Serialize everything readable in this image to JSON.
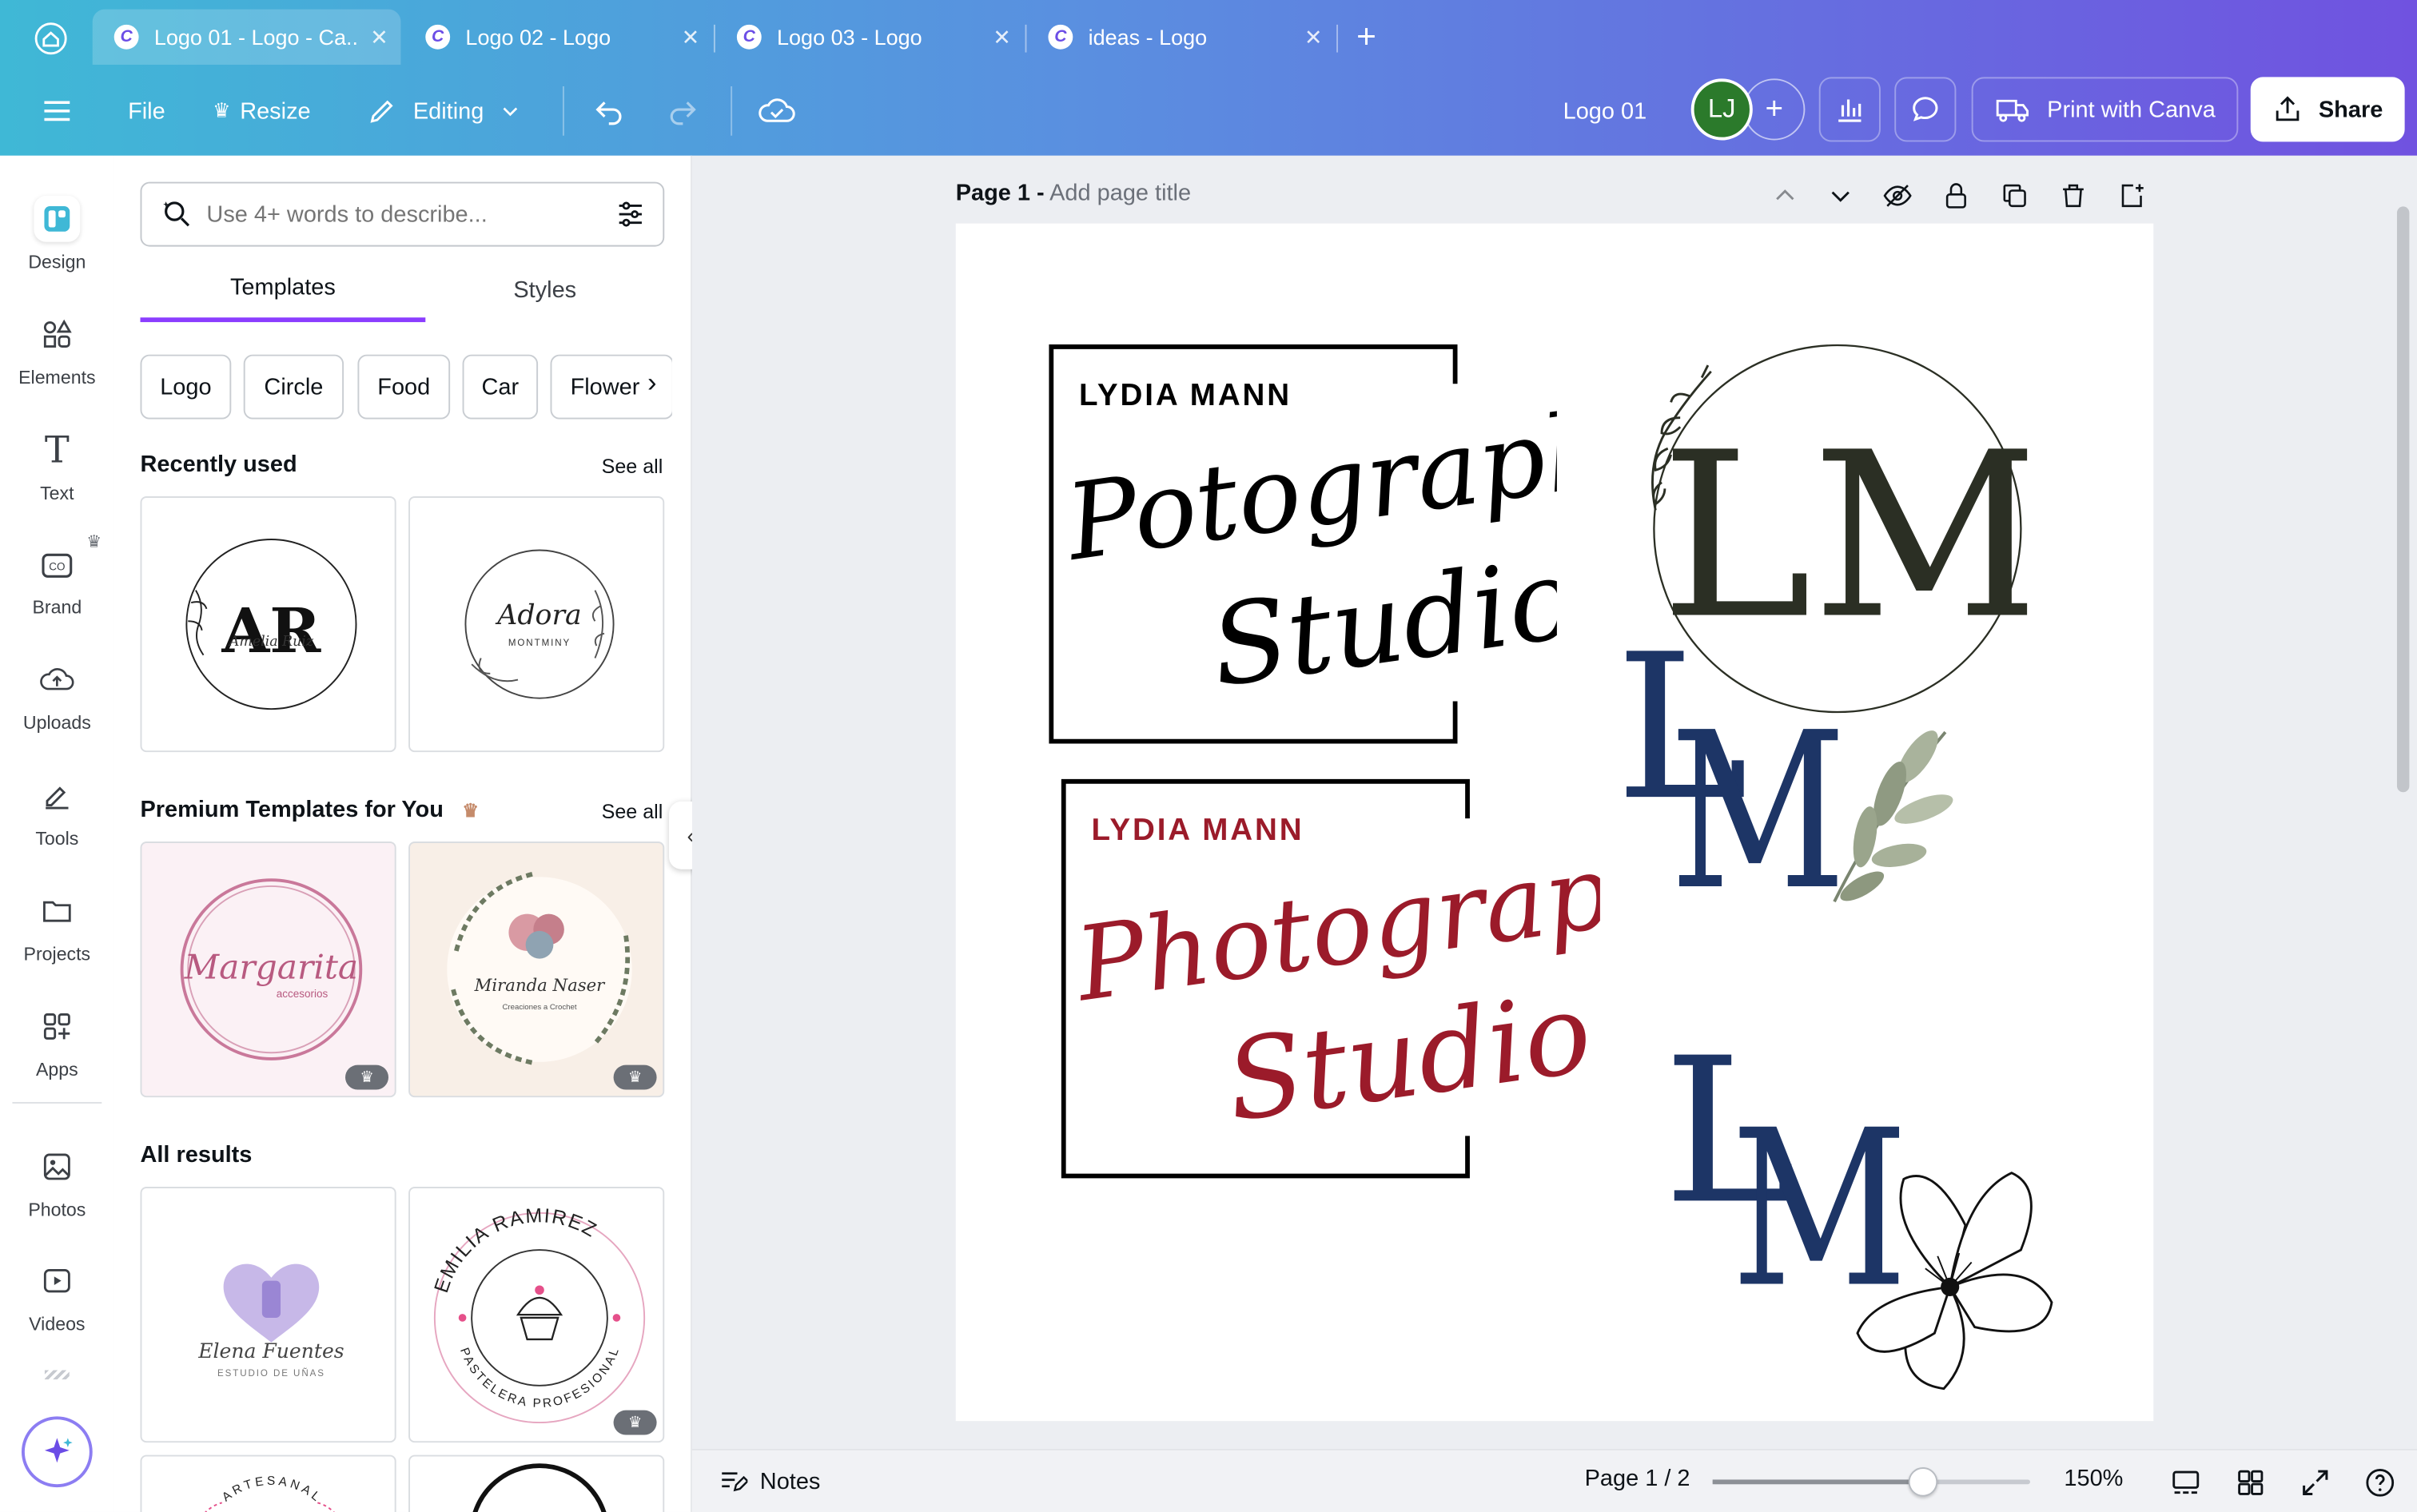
{
  "tabs": [
    {
      "title": "Logo 01 - Logo - Ca...",
      "active": true
    },
    {
      "title": "Logo 02 - Logo",
      "active": false
    },
    {
      "title": "Logo 03 - Logo",
      "active": false
    },
    {
      "title": "ideas - Logo",
      "active": false
    }
  ],
  "toolbar": {
    "file": "File",
    "resize": "Resize",
    "editing": "Editing",
    "doc_title": "Logo 01",
    "avatar_initials": "LJ",
    "print": "Print with Canva",
    "share": "Share"
  },
  "rail": [
    {
      "label": "Design",
      "icon": "design-icon"
    },
    {
      "label": "Elements",
      "icon": "elements-icon"
    },
    {
      "label": "Text",
      "icon": "text-icon"
    },
    {
      "label": "Brand",
      "icon": "brand-icon"
    },
    {
      "label": "Uploads",
      "icon": "uploads-icon"
    },
    {
      "label": "Tools",
      "icon": "tools-icon"
    },
    {
      "label": "Projects",
      "icon": "projects-icon"
    },
    {
      "label": "Apps",
      "icon": "apps-icon"
    },
    {
      "label": "Photos",
      "icon": "photos-icon"
    },
    {
      "label": "Videos",
      "icon": "videos-icon"
    }
  ],
  "panel": {
    "search_placeholder": "Use 4+ words to describe...",
    "tab_templates": "Templates",
    "tab_styles": "Styles",
    "chips": [
      "Logo",
      "Circle",
      "Food",
      "Car",
      "Flower"
    ],
    "recently_used": "Recently used",
    "premium": "Premium Templates for You",
    "all_results": "All results",
    "see_all": "See all"
  },
  "templates": {
    "recent1": {
      "initials": "AR",
      "name": "Amelia Ruiz"
    },
    "recent2": {
      "name": "Adora",
      "sub": "MONTMINY"
    },
    "premium1": {
      "name": "Margarita",
      "sub": "accesorios"
    },
    "premium2": {
      "name": "Miranda Naser",
      "sub": "Creaciones a Crochet"
    },
    "result1": {
      "name": "Elena Fuentes",
      "sub": "ESTUDIO DE UÑAS"
    },
    "result2": {
      "top": "EMILIA RAMIREZ",
      "bottom": "PASTELERA PROFESIONAL"
    },
    "result3": {
      "top": "ARTESANAL"
    }
  },
  "canvas": {
    "page_label": "Page 1 -",
    "page_title_placeholder": "Add page title",
    "logo1": {
      "name": "LYDIA MANN",
      "line1": "Potography",
      "line2": "Studio",
      "color": "#000000"
    },
    "logo2": {
      "name": "LYDIA MANN",
      "line1": "Photography",
      "line2": "Studio",
      "color": "#9b1b2a"
    },
    "logo3": {
      "initials": "LM",
      "color": "#2b2f24"
    },
    "logo4": {
      "initials_l": "L",
      "initials_m": "M",
      "color": "#1d3566"
    },
    "logo5": {
      "initials_l": "L",
      "initials_m": "M",
      "color": "#1d3566"
    }
  },
  "footer": {
    "notes": "Notes",
    "page_count": "Page 1 / 2",
    "zoom": "150%",
    "zoom_level": 0.66
  }
}
